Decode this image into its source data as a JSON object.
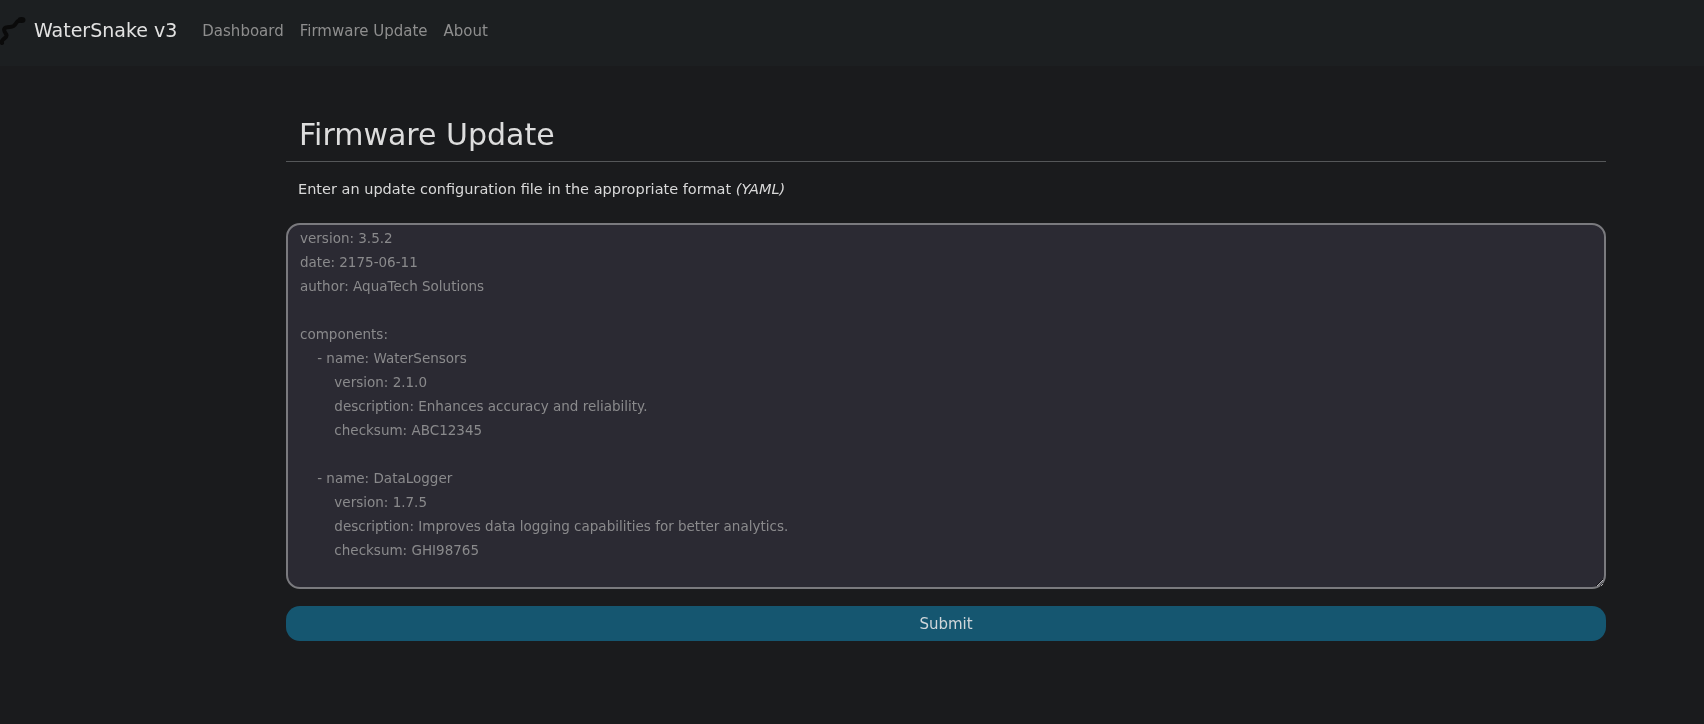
{
  "navbar": {
    "brand": "WaterSnake v3",
    "links": [
      "Dashboard",
      "Firmware Update",
      "About"
    ]
  },
  "page": {
    "title": "Firmware Update",
    "description": "Enter an update configuration file in the appropriate format *(YAML)*",
    "editor": {
      "placeholder": "version: 3.5.2\ndate: 2175-06-11\nauthor: AquaTech Solutions\n\ncomponents:\n    - name: WaterSensors\n        version: 2.1.0\n        description: Enhances accuracy and reliability.\n        checksum: ABC12345\n\n    - name: DataLogger\n        version: 1.7.5\n        description: Improves data logging capabilities for better analytics.\n        checksum: GHI98765"
    },
    "submit_button": "Submit"
  }
}
